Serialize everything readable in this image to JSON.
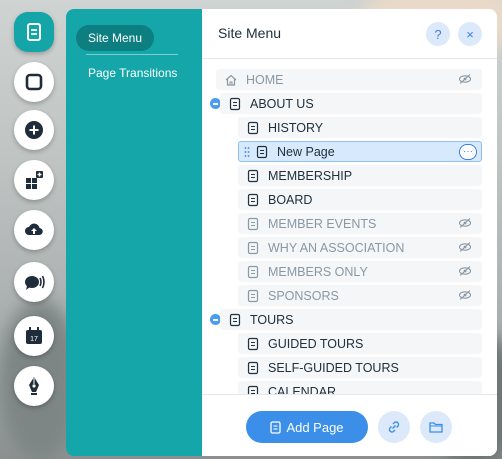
{
  "teal_panel": {
    "active_tab": "Site Menu",
    "link": "Page Transitions"
  },
  "panel": {
    "title": "Site Menu",
    "help_label": "?",
    "close_label": "×"
  },
  "pages": [
    {
      "label": "HOME",
      "level": 0,
      "hidden": true,
      "icon": "home-icon"
    },
    {
      "label": "ABOUT US",
      "level": 0,
      "hidden": false,
      "icon": "page-icon",
      "expanded": true
    },
    {
      "label": "HISTORY",
      "level": 1,
      "hidden": false,
      "icon": "page-icon"
    },
    {
      "label": "New Page",
      "level": 1,
      "hidden": false,
      "icon": "page-icon",
      "selected": true
    },
    {
      "label": "MEMBERSHIP",
      "level": 1,
      "hidden": false,
      "icon": "page-icon"
    },
    {
      "label": "BOARD",
      "level": 1,
      "hidden": false,
      "icon": "page-icon"
    },
    {
      "label": "MEMBER EVENTS",
      "level": 1,
      "hidden": true,
      "icon": "page-icon"
    },
    {
      "label": "WHY AN ASSOCIATION",
      "level": 1,
      "hidden": true,
      "icon": "page-icon"
    },
    {
      "label": "MEMBERS ONLY",
      "level": 1,
      "hidden": true,
      "icon": "page-icon"
    },
    {
      "label": "SPONSORS",
      "level": 1,
      "hidden": true,
      "icon": "page-icon"
    },
    {
      "label": "TOURS",
      "level": 0,
      "hidden": false,
      "icon": "page-icon",
      "expanded": true
    },
    {
      "label": "GUIDED TOURS",
      "level": 1,
      "hidden": false,
      "icon": "page-icon"
    },
    {
      "label": "SELF-GUIDED TOURS",
      "level": 1,
      "hidden": false,
      "icon": "page-icon"
    },
    {
      "label": "CALENDAR",
      "level": 1,
      "hidden": false,
      "icon": "page-icon"
    }
  ],
  "footer": {
    "add_page_label": "Add Page"
  },
  "rail_icons": [
    "pages-icon",
    "background-icon",
    "add-icon",
    "apps-icon",
    "upload-icon",
    "chat-icon",
    "bookings-icon",
    "blog-pen-icon"
  ],
  "colors": {
    "teal": "#14a6a8",
    "accent_blue": "#3b8fe8",
    "selected_row": "#d7e9fc"
  }
}
